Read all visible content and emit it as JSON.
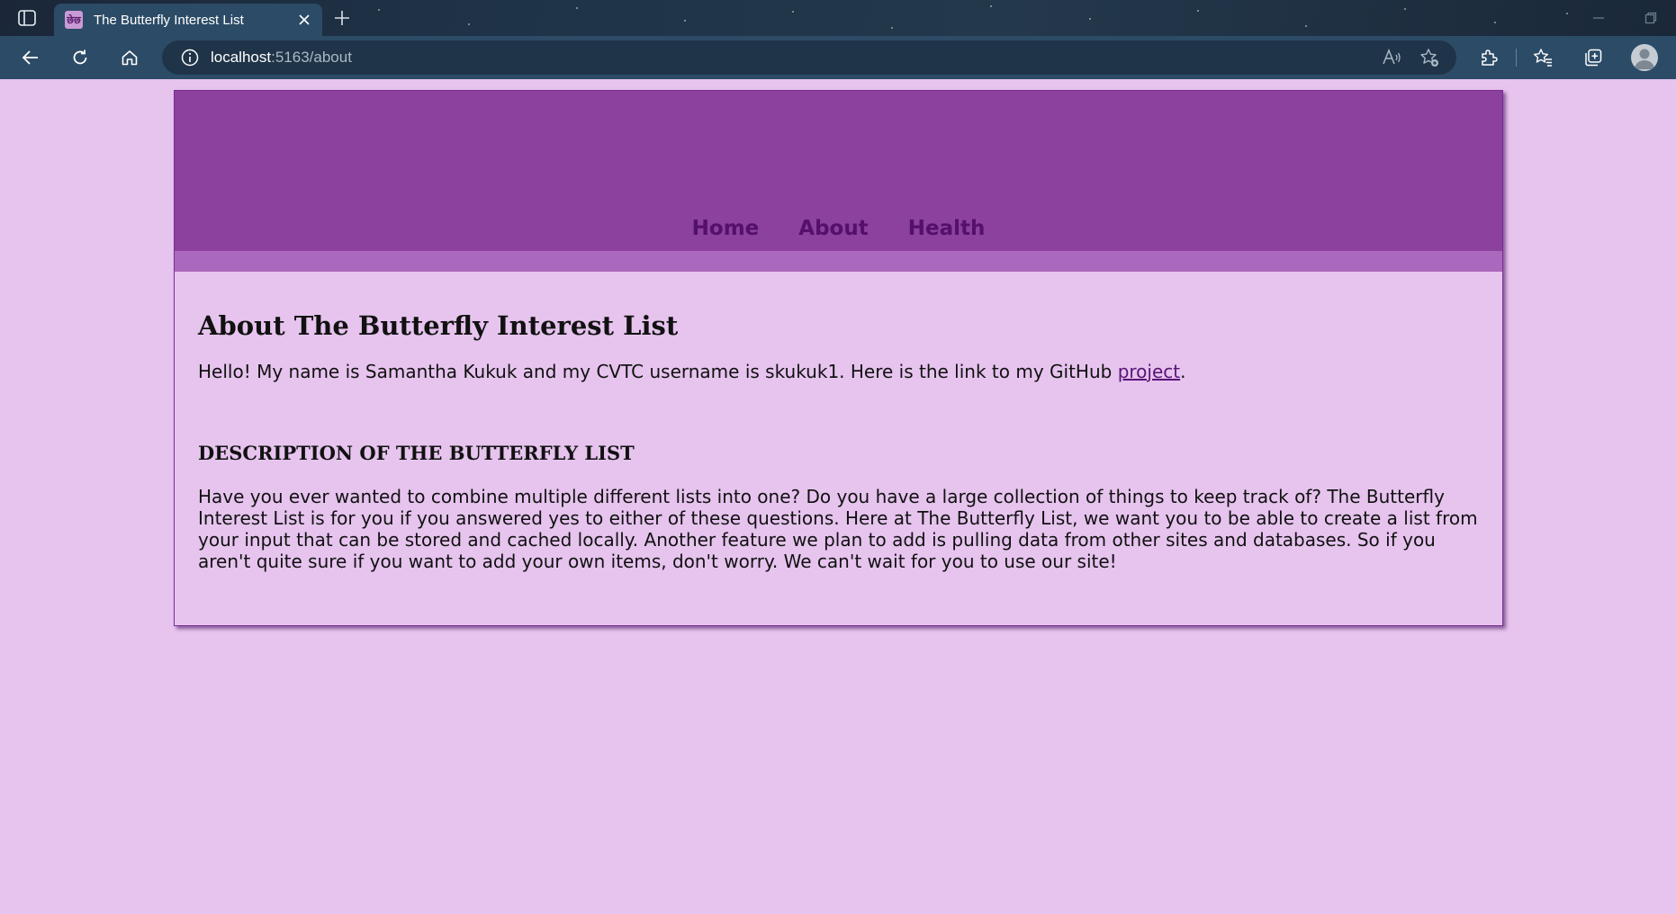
{
  "browser": {
    "tab_title": "The Butterfly Interest List",
    "tab_favicon_text": "छेछ",
    "url_host": "localhost",
    "url_rest": ":5163/about"
  },
  "site": {
    "nav": [
      {
        "label": "Home"
      },
      {
        "label": "About"
      },
      {
        "label": "Health"
      }
    ]
  },
  "about": {
    "heading": "About The Butterfly Interest List",
    "intro_prefix": "Hello! My name is Samantha Kukuk and my CVTC username is skukuk1. Here is the link to my GitHub ",
    "intro_link": "project",
    "intro_suffix": ".",
    "subheading": "DESCRIPTION OF THE BUTTERFLY LIST",
    "description": "Have you ever wanted to combine multiple different lists into one? Do you have a large collection of things to keep track of? The Butterfly Interest List is for you if you answered yes to either of these questions. Here at The Butterfly List, we want you to be able to create a list from your input that can be stored and cached locally. Another feature we plan to add is pulling data from other sites and databases. So if you aren't quite sure if you want to add your own items, don't worry. We can't wait for you to use our site!"
  },
  "colors": {
    "page_bg": "#e6c4ee",
    "header_bg": "#8b419d",
    "header_strip": "#ab69bd",
    "nav_text": "#55106a",
    "card_border": "#7a2e93"
  },
  "icons": [
    "tab-actions-icon",
    "favicon-icon",
    "close-icon",
    "plus-icon",
    "back-icon",
    "refresh-icon",
    "home-icon",
    "info-icon",
    "read-aloud-icon",
    "add-favorite-icon",
    "extensions-icon",
    "favorites-icon",
    "collections-icon",
    "profile-icon",
    "restore-window-icon",
    "minimize-icon"
  ]
}
